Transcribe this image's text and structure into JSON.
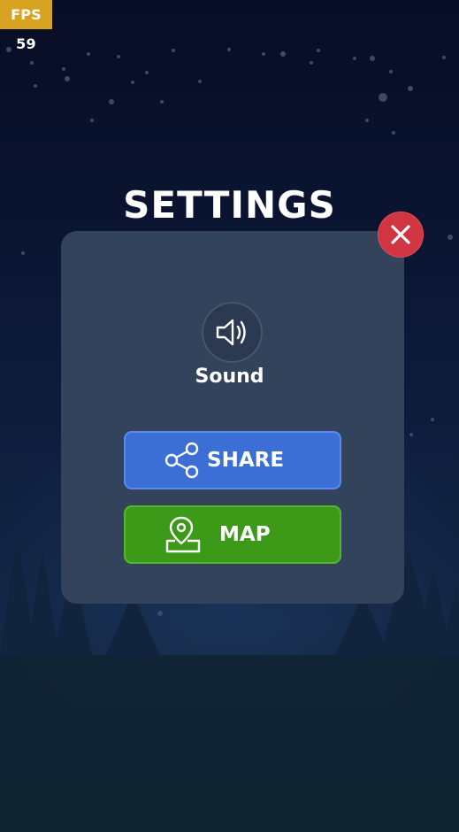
{
  "hud": {
    "fps_text": "FPS 59"
  },
  "dialog": {
    "title": "SETTINGS",
    "sound_label": "Sound",
    "share_label": "SHARE",
    "map_label": "MAP"
  },
  "icons": {
    "close": "close-icon",
    "sound": "speaker-icon",
    "share": "share-icon",
    "map": "map-pin-icon"
  },
  "colors": {
    "fps_badge": "#d8a321",
    "panel": "#33435c",
    "close_button": "#d13541",
    "share_button": "#3b6fd6",
    "map_button": "#3d9a18",
    "sky_top": "#070d24",
    "ground": "#112331"
  }
}
